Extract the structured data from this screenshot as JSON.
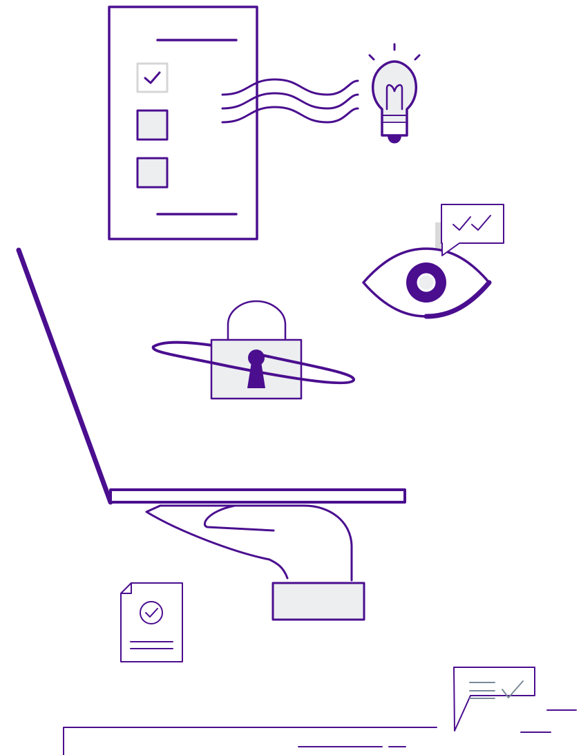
{
  "colors": {
    "primary": "#4a0e8f",
    "fill": "#eceef0",
    "muted_stroke": "#c9c9c9",
    "slate": "#7a8a99",
    "background": "#ffffff"
  },
  "illustration": {
    "elements": [
      "checklist-document",
      "light-bulb-icon",
      "eye-icon",
      "double-check-chat-icon",
      "padlock-icon",
      "laptop",
      "hand",
      "approved-document-icon",
      "chat-checklist-icon"
    ],
    "checklist": {
      "items": [
        {
          "checked": true
        },
        {
          "checked": false
        },
        {
          "checked": false
        }
      ]
    }
  }
}
